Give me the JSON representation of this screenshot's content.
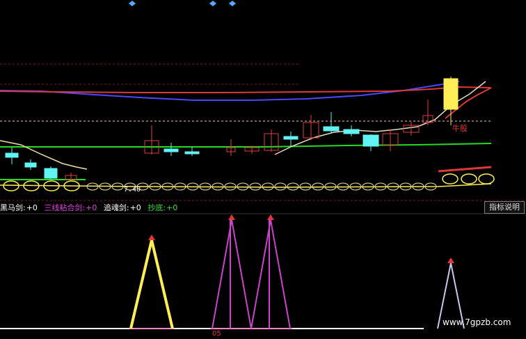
{
  "colors": {
    "background": "#000000",
    "red": "#e03838",
    "blue": "#4848ff",
    "green": "#22dd22",
    "white": "#ffffff",
    "cyan": "#5ff3f3",
    "yellow": "#ffee55",
    "magenta": "#cc44cc",
    "lavender": "#c8c8ee",
    "bullish": "#e04040",
    "bearish": "#5ff3f3",
    "diamond": "#55aaff",
    "grid_red": "#8c1414"
  },
  "price_panel": {
    "stock_label": "牛股",
    "price_label": "7.40"
  },
  "legend": [
    {
      "label": "黑马剑:",
      "value": "+0",
      "color": "#ffffff"
    },
    {
      "label": "三线粘合剑:",
      "value": "+0",
      "color": "#dd44dd"
    },
    {
      "label": "追魂剑:",
      "value": "+0",
      "color": "#ffffff"
    },
    {
      "label": "抄底:",
      "value": "+0",
      "color": "#33dd33"
    }
  ],
  "help_button": "指标说明",
  "axis_label": "05",
  "watermark": "www.7gpzb.com",
  "icons": {
    "marker": "diamond-icon",
    "signal": "triangle-up-icon"
  }
}
